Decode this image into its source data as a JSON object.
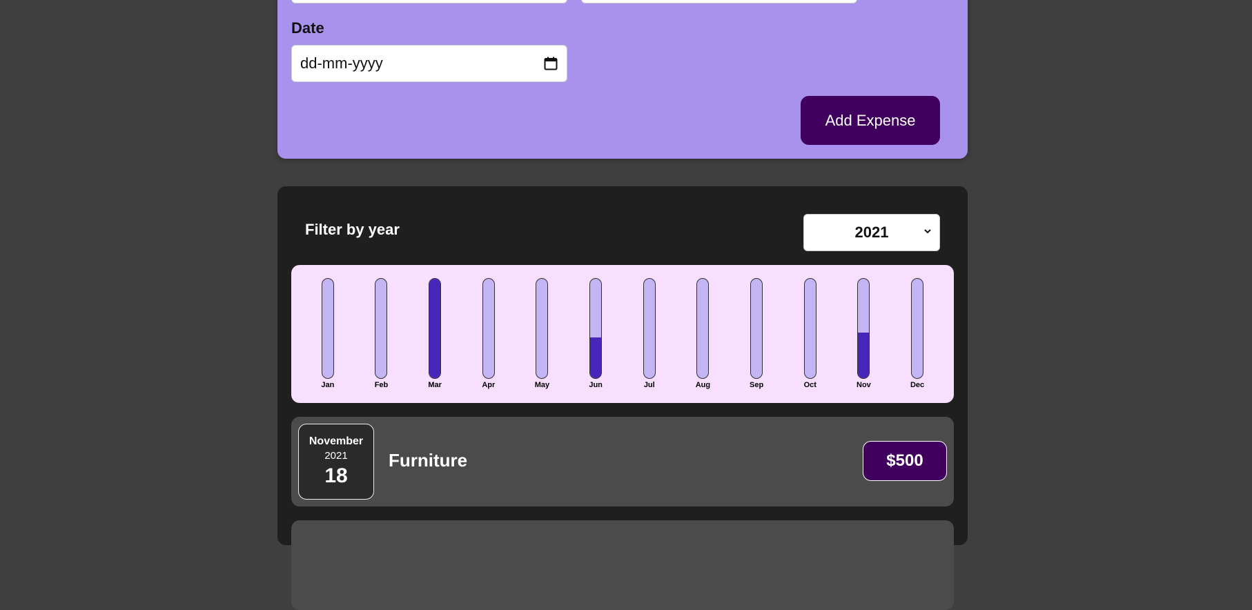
{
  "form": {
    "date_label": "Date",
    "date_placeholder": "dd-mm-yyyy",
    "submit_label": "Add Expense"
  },
  "filter": {
    "label": "Filter by year",
    "selected_year": "2021"
  },
  "chart_data": {
    "type": "bar",
    "categories": [
      "Jan",
      "Feb",
      "Mar",
      "Apr",
      "May",
      "Jun",
      "Jul",
      "Aug",
      "Sep",
      "Oct",
      "Nov",
      "Dec"
    ],
    "fill_fractions": [
      0,
      0,
      1.0,
      0,
      0,
      0.41,
      0,
      0,
      0,
      0,
      0.46,
      0
    ],
    "colors": {
      "track": "#c3b4f3",
      "fill": "#4826b9"
    }
  },
  "expenses": [
    {
      "month": "November",
      "year": "2021",
      "day": "18",
      "title": "Furniture",
      "amount": "$500"
    }
  ],
  "colors": {
    "page_bg": "#3f3f3f",
    "form_bg": "#a892ed",
    "primary": "#40005d",
    "card_bg": "#1f1f1f",
    "chart_bg": "#f8dfff",
    "item_bg": "#4b4b4b"
  }
}
